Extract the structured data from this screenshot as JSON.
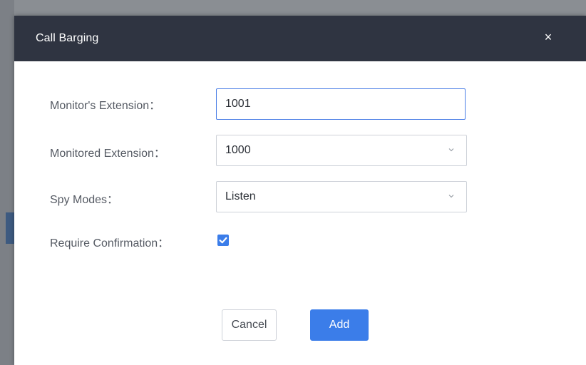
{
  "dialog": {
    "title": "Call Barging",
    "close_glyph": "×",
    "close_icon": "close-icon"
  },
  "form": {
    "monitor_extension": {
      "label": "Monitor's Extension：",
      "value": "1001"
    },
    "monitored_extension": {
      "label": "Monitored Extension：",
      "value": "1000",
      "icon": "chevron-down-icon"
    },
    "spy_modes": {
      "label": "Spy Modes：",
      "value": "Listen",
      "icon": "chevron-down-icon"
    },
    "require_confirmation": {
      "label": "Require Confirmation：",
      "checked": true
    }
  },
  "buttons": {
    "cancel": "Cancel",
    "add": "Add"
  },
  "colors": {
    "header_bg": "#2f3441",
    "accent": "#3b7de9",
    "label_text": "#555a63",
    "border": "#cdd1d8"
  }
}
